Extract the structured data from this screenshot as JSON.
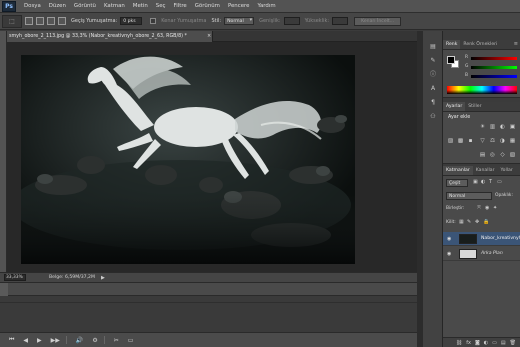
{
  "menubar": {
    "logo": "Ps",
    "items": [
      "Dosya",
      "Düzen",
      "Görüntü",
      "Katman",
      "Metin",
      "Seç",
      "Filtre",
      "Görünüm",
      "Pencere",
      "Yardım"
    ]
  },
  "options": {
    "feather_label": "Geçiş Yumuşatma:",
    "feather_value": "0 pks",
    "antialias_label": "Kenar Yumuşatma",
    "style_label": "Stil:",
    "style_value": "Normal",
    "width_label": "Genişlik:",
    "height_label": "Yükseklik:",
    "refine_label": "Kenarı İncelt..."
  },
  "document": {
    "tab_title": "smyh_obore_2_113.jpg @ 33,3% (Nabor_kreativnyh_obore_2_63, RGB/8) *",
    "close_symbol": "×"
  },
  "status": {
    "zoom": "33,33%",
    "doc_size": "Belge: 6,59M/37,2M",
    "arrow": "▶"
  },
  "timeline": {
    "buttons": [
      "⏮",
      "◀",
      "▶",
      "▶▶",
      "🔊",
      "⚙",
      "✂",
      "▭"
    ]
  },
  "color_panel": {
    "tabs": [
      "Renk",
      "Renk Örnekleri"
    ],
    "menu": "≡",
    "sliders": [
      {
        "label": "R",
        "color": "#c23b3b"
      },
      {
        "label": "G",
        "color": "#3bb24a"
      },
      {
        "label": "B",
        "color": "#3b6dd1"
      }
    ]
  },
  "adjustments_panel": {
    "tabs": [
      "Ayarlar",
      "Stiller"
    ],
    "title": "Ayar ekle",
    "icons": [
      "☀",
      "▥",
      "◐",
      "▣",
      "▽",
      "⚖",
      "◑",
      "▦",
      "▤",
      "◎",
      "◇",
      "▧",
      "▨",
      "▩",
      "▪"
    ]
  },
  "layers_panel": {
    "tabs": [
      "Katmanlar",
      "Kanallar",
      "Yollar"
    ],
    "filter_kind": "Çeşit",
    "blend_mode": "Normal",
    "opacity_label": "Opaklık:",
    "opacity_value": "100%",
    "lock_label": "Kilit:",
    "fill_label": "Dolgu:",
    "fill_value": "100%",
    "unify_label": "Birleştir:",
    "layers": [
      {
        "name": "Nabor_kreativnyh",
        "selected": true,
        "italic": false
      },
      {
        "name": "Arka Plan",
        "selected": false,
        "italic": true
      }
    ],
    "footer_icons": [
      "⛓",
      "fx",
      "◙",
      "◐",
      "▭",
      "▤",
      "🗑"
    ]
  },
  "colors": {
    "ui_dark": "#3b3b3b",
    "panel": "#4a4a4a",
    "selected_layer": "#3b5577"
  }
}
